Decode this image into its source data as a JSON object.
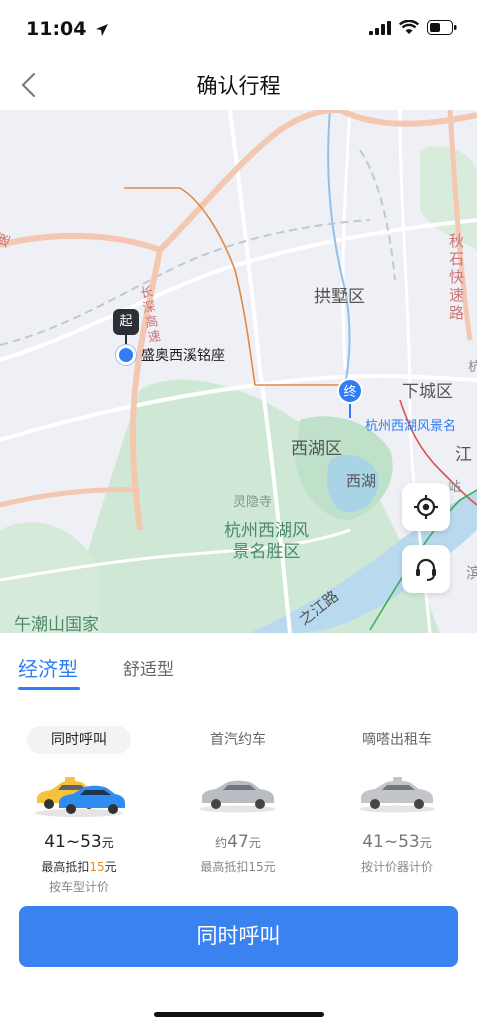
{
  "status": {
    "time": "11:04"
  },
  "nav": {
    "title": "确认行程"
  },
  "map": {
    "start_marker": "起",
    "start_name": "盛奥西溪铭座",
    "end_marker": "终",
    "end_name": "杭州西湖风景名",
    "labels": {
      "gongshu": "拱墅区",
      "xiacheng": "下城区",
      "xihu_district": "西湖区",
      "xihu_lake": "西湖",
      "lingyin": "灵隐寺",
      "scenic_area_line1": "杭州西湖风",
      "scenic_area_line2": "景名胜区",
      "wuchaoshan": "午潮山国家",
      "zhijiang": "之江路",
      "changshen": "长深高速",
      "qiushi": "秋石快速路",
      "jiang_fragment": "江",
      "su_fragment": "速",
      "zhan_fragment": "站",
      "hang_fragment": "杭",
      "bin_fragment": "滨"
    }
  },
  "tabs": [
    {
      "label": "经济型",
      "active": true
    },
    {
      "label": "舒适型",
      "active": false
    }
  ],
  "options": [
    {
      "name": "同时呼叫",
      "price": "41~53",
      "unit": "元",
      "note_prefix": "最高抵扣",
      "note_value": "15",
      "note_suffix": "元",
      "note2": "按车型计价",
      "selected": true
    },
    {
      "name": "首汽约车",
      "price_prefix": "约",
      "price": "47",
      "unit": "元",
      "note": "最高抵扣15元",
      "selected": false
    },
    {
      "name": "嘀嗒出租车",
      "price": "41~53",
      "unit": "元",
      "note": "按计价器计价",
      "selected": false
    }
  ],
  "call_button": "同时呼叫",
  "colors": {
    "accent": "#2f7cf6",
    "button": "#3a82f0",
    "highlight": "#f08a24"
  }
}
